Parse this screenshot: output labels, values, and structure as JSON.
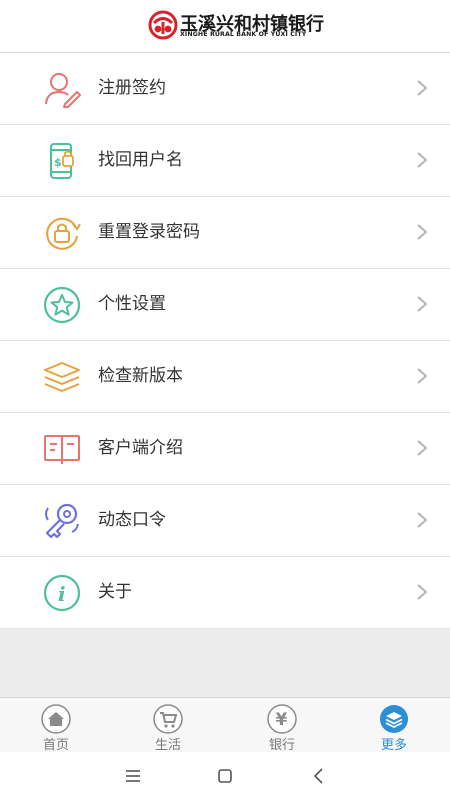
{
  "header": {
    "bank_name_cn": "玉溪兴和村镇银行",
    "bank_name_en": "XINGHE RURAL BANK OF YUXI CITY"
  },
  "menu": {
    "items": [
      {
        "label": "注册签约",
        "icon": "user-pen-icon",
        "color": "#e8736f"
      },
      {
        "label": "找回用户名",
        "icon": "phone-money-icon",
        "color": "#4dbf9b"
      },
      {
        "label": "重置登录密码",
        "icon": "lock-refresh-icon",
        "color": "#e8a13c"
      },
      {
        "label": "个性设置",
        "icon": "star-circle-icon",
        "color": "#4dbf9b"
      },
      {
        "label": "检查新版本",
        "icon": "layers-icon",
        "color": "#e8a13c"
      },
      {
        "label": "客户端介绍",
        "icon": "book-icon",
        "color": "#e8736f"
      },
      {
        "label": "动态口令",
        "icon": "key-icon",
        "color": "#6f73d8"
      },
      {
        "label": "关于",
        "icon": "info-icon",
        "color": "#4dbf9b"
      }
    ]
  },
  "tabbar": {
    "tabs": [
      {
        "label": "首页",
        "icon": "home-icon",
        "active": false
      },
      {
        "label": "生活",
        "icon": "cart-icon",
        "active": false
      },
      {
        "label": "银行",
        "icon": "yen-icon",
        "active": false
      },
      {
        "label": "更多",
        "icon": "layers-icon",
        "active": true
      }
    ],
    "active_color": "#2a8fd6",
    "inactive_color": "#7a7a7a"
  },
  "system_nav": {
    "buttons": [
      "menu-icon",
      "home-square-icon",
      "back-icon"
    ]
  }
}
